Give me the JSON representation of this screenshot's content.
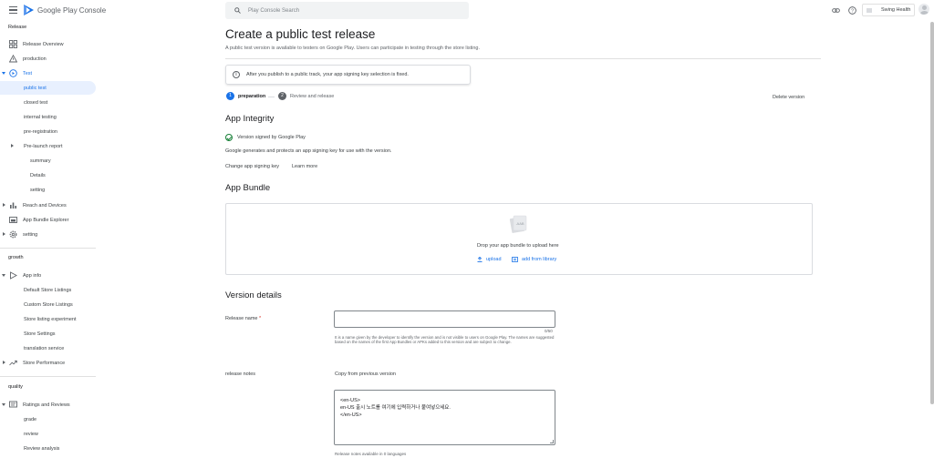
{
  "app": {
    "brand": "Google Play Console"
  },
  "search": {
    "placeholder": "Play Console Search"
  },
  "account": {
    "name": "Swing Health"
  },
  "sidebar": {
    "release_label": "Release",
    "growth_label": "growth",
    "quality_label": "quality",
    "items": {
      "release_overview": "Release Overview",
      "production": "production",
      "test": "Test",
      "public_test": "public test",
      "closed_test": "closed test",
      "internal_testing": "internal testing",
      "pre_registration": "pre-registration",
      "pre_launch_report": "Pre-launch report",
      "summary": "summary",
      "details": "Details",
      "setting_sub": "setting",
      "reach_devices": "Reach and Devices",
      "bundle_explorer": "App Bundle Explorer",
      "setting": "setting",
      "app_info": "App info",
      "default_listings": "Default Store Listings",
      "custom_listings": "Custom Store Listings",
      "listing_experiment": "Store listing experiment",
      "store_settings": "Store Settings",
      "translation": "translation service",
      "store_performance": "Store Performance",
      "ratings_reviews": "Ratings and Reviews",
      "grade": "grade",
      "review": "review",
      "review_analysis": "Review analysis"
    }
  },
  "main": {
    "title": "Create a public test release",
    "subtitle": "A public test version is available to testers on Google Play. Users can participate in testing through the store listing.",
    "alert": "After you publish to a public track, your app signing key selection is fixed.",
    "steps": [
      {
        "num": "1",
        "label": "preparation"
      },
      {
        "num": "2",
        "label": "Review and release"
      }
    ],
    "delete_version": "Delete version",
    "integrity": {
      "heading": "App Integrity",
      "signed": "Version signed by Google Play",
      "desc": "Google generates and protects an app signing key for use with the version.",
      "change_key": "Change app signing key",
      "learn_more": "Learn more"
    },
    "bundle": {
      "heading": "App Bundle",
      "drop_text": "Drop your app bundle to upload here",
      "upload": "upload",
      "add_library": "add from library"
    },
    "version": {
      "heading": "Version details",
      "release_name_label": "Release name",
      "required_mark": "*",
      "release_name_value": "",
      "counter": "0/50",
      "helper": "It is a name given by the developer to identify the version and is not visible to users on Google Play. The names are suggested based on the names of the first App Bundles or APKs added to this version and are subject to change.",
      "notes_label": "release notes",
      "copy_previous": "Copy from previous version",
      "notes_lines": [
        "<en-US>",
        "en-US 출시 노트를 여기에 입력하거나 붙여넣으세요.",
        "</en-US>"
      ],
      "notes_footer": "Release notes available in 0 languages"
    }
  },
  "colors": {
    "accent": "#1a73e8",
    "active_bg": "#e8f0fe",
    "success": "#188038"
  }
}
